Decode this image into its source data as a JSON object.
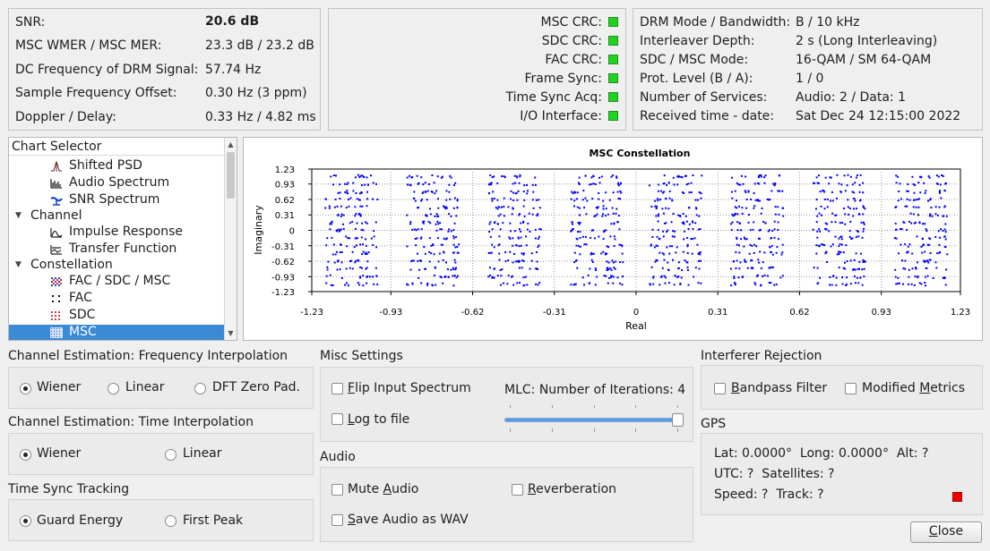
{
  "status": {
    "snr_label": "SNR:",
    "snr_value": "20.6 dB",
    "mer_label": "MSC WMER / MSC MER:",
    "mer_value": "23.3 dB / 23.2 dB",
    "dcfreq_label": "DC Frequency of DRM Signal:",
    "dcfreq_value": "57.74 Hz",
    "sfo_label": "Sample Frequency Offset:",
    "sfo_value": "0.30 Hz (3 ppm)",
    "doppler_label": "Doppler / Delay:",
    "doppler_value": "0.33 Hz / 4.82 ms"
  },
  "crc": {
    "items": [
      {
        "label": "MSC CRC:",
        "color": "#1ed41e"
      },
      {
        "label": "SDC CRC:",
        "color": "#1ed41e"
      },
      {
        "label": "FAC CRC:",
        "color": "#1ed41e"
      },
      {
        "label": "Frame Sync:",
        "color": "#1ed41e"
      },
      {
        "label": "Time Sync Acq:",
        "color": "#1ed41e"
      },
      {
        "label": "I/O Interface:",
        "color": "#1ed41e"
      }
    ]
  },
  "params": {
    "items": [
      {
        "label": "DRM Mode / Bandwidth:",
        "value": "B / 10 kHz"
      },
      {
        "label": "Interleaver Depth:",
        "value": "2 s (Long Interleaving)"
      },
      {
        "label": "SDC / MSC Mode:",
        "value": "16-QAM / SM 64-QAM"
      },
      {
        "label": "Prot. Level (B / A):",
        "value": "1 / 0"
      },
      {
        "label": "Number of Services:",
        "value": "Audio: 2 / Data: 1"
      },
      {
        "label": "Received time - date:",
        "value": "Sat Dec 24 12:15:00 2022"
      }
    ]
  },
  "chart_selector": {
    "header": "Chart Selector",
    "items": [
      {
        "label": "Shifted PSD",
        "icon": "psd-icon",
        "level": 2
      },
      {
        "label": "Audio Spectrum",
        "icon": "audio-spectrum-icon",
        "level": 2
      },
      {
        "label": "SNR Spectrum",
        "icon": "snr-spectrum-icon",
        "level": 2
      },
      {
        "label": "Channel",
        "icon": "expand-arrow-icon",
        "level": 1
      },
      {
        "label": "Impulse Response",
        "icon": "impulse-response-icon",
        "level": 2
      },
      {
        "label": "Transfer Function",
        "icon": "transfer-function-icon",
        "level": 2
      },
      {
        "label": "Constellation",
        "icon": "expand-arrow-icon",
        "level": 1
      },
      {
        "label": "FAC / SDC / MSC",
        "icon": "constellation-all-icon",
        "level": 2
      },
      {
        "label": "FAC",
        "icon": "fac-icon",
        "level": 2
      },
      {
        "label": "SDC",
        "icon": "sdc-icon",
        "level": 2
      },
      {
        "label": "MSC",
        "icon": "msc-icon",
        "level": 2,
        "selected": true
      }
    ]
  },
  "chart_data": {
    "type": "scatter",
    "title": "MSC Constellation",
    "xlabel": "Real",
    "ylabel": "Imaginary",
    "xlim": [
      -1.23,
      1.23
    ],
    "ylim": [
      -1.23,
      1.23
    ],
    "xticks": [
      "-1.23",
      "-0.93",
      "-0.62",
      "-0.31",
      "0",
      "0.31",
      "0.62",
      "0.93",
      "1.23"
    ],
    "yticks": [
      "1.23",
      "0.93",
      "0.62",
      "0.31",
      "0",
      "-0.31",
      "-0.62",
      "-0.93",
      "-1.23"
    ],
    "grid": true,
    "color": "#0000ff",
    "x_centers": [
      -1.08,
      -0.77,
      -0.46,
      -0.15,
      0.15,
      0.46,
      0.77,
      1.08
    ],
    "y_levels": [
      1.08,
      0.93,
      0.77,
      0.62,
      0.46,
      0.31,
      0.15,
      0,
      -0.15,
      -0.31,
      -0.46,
      -0.62,
      -0.77,
      -0.93,
      -1.08
    ],
    "points_per_cluster": 12
  },
  "freq_interp": {
    "title": "Channel Estimation: Frequency Interpolation",
    "options": [
      {
        "label": "Wiener",
        "checked": true
      },
      {
        "label": "Linear",
        "checked": false
      },
      {
        "label": "DFT Zero Pad.",
        "checked": false
      }
    ]
  },
  "time_interp": {
    "title": "Channel Estimation: Time Interpolation",
    "options": [
      {
        "label": "Wiener",
        "checked": true
      },
      {
        "label": "Linear",
        "checked": false
      }
    ]
  },
  "time_sync": {
    "title": "Time Sync Tracking",
    "options": [
      {
        "label": "Guard Energy",
        "checked": true
      },
      {
        "label": "First Peak",
        "checked": false
      }
    ]
  },
  "misc": {
    "title": "Misc Settings",
    "flip_first": "F",
    "flip_rest": "lip Input Spectrum",
    "log_first": "L",
    "log_rest": "og to file",
    "mlc_label": "MLC: Number of Iterations: 4",
    "mlc_value": 4,
    "mlc_max": 4
  },
  "audio": {
    "title": "Audio",
    "mute_pre": "Mute ",
    "mute_u": "A",
    "mute_rest": "udio",
    "reverb_u": "R",
    "reverb_rest": "everberation",
    "save_u": "S",
    "save_rest": "ave Audio as WAV"
  },
  "interferer": {
    "title": "Interferer Rejection",
    "bandpass_u": "B",
    "bandpass_rest": "andpass Filter",
    "modified_pre": "Modified ",
    "modified_u": "M",
    "modified_rest": "etrics"
  },
  "gps": {
    "title": "GPS",
    "line1": "Lat: 0.0000°  Long: 0.0000°  Alt: ?",
    "line2": "UTC: ?  Satellites: ?",
    "line3": "Speed: ?  Track: ?",
    "indicator_color": "#ee0000"
  },
  "close": {
    "first": "C",
    "rest": "lose"
  }
}
